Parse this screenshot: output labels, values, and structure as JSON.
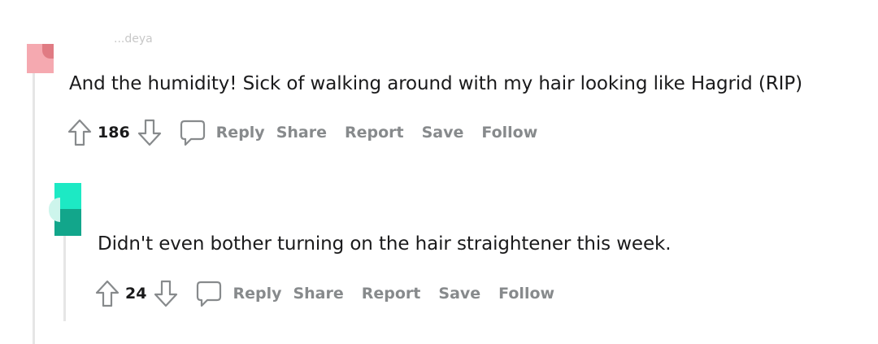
{
  "comments": [
    {
      "author": "...deya",
      "avatar_colors": [
        "#f2a3ac",
        "#e2757f"
      ],
      "body": "And the humidity! Sick of walking around with my hair looking like Hagrid (RIP)",
      "votes": "186",
      "actions": {
        "reply": "Reply",
        "share": "Share",
        "report": "Report",
        "save": "Save",
        "follow": "Follow"
      }
    },
    {
      "author": "",
      "avatar_colors": [
        "#1de9c4",
        "#10a88d"
      ],
      "body": "Didn't even bother turning on the hair straightener this week.",
      "votes": "24",
      "actions": {
        "reply": "Reply",
        "share": "Share",
        "report": "Report",
        "save": "Save",
        "follow": "Follow"
      }
    }
  ],
  "icons": {
    "upvote": "arrow-up-icon",
    "downvote": "arrow-down-icon",
    "comment": "comment-bubble-icon"
  }
}
